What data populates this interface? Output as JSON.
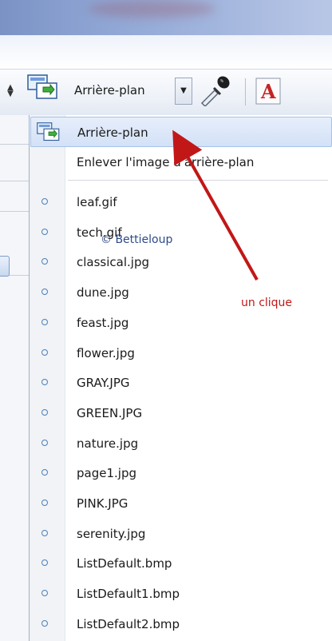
{
  "toolbar": {
    "background_dropdown_label": "Arrière-plan",
    "spin_icon": "up-down-arrows-icon",
    "background_icon": "background-image-icon",
    "dropdown_arrow_icon": "chevron-down-icon",
    "eyedropper_icon": "eyedropper-icon",
    "text_icon": "text-color-icon"
  },
  "menu": {
    "top_items": [
      {
        "label": "Arrière-plan",
        "highlighted": true,
        "icon": "background-image-icon"
      },
      {
        "label": "Enlever l'image d'arrière-plan",
        "highlighted": false
      }
    ],
    "files": [
      "leaf.gif",
      "tech.gif",
      "classical.jpg",
      "dune.jpg",
      "feast.jpg",
      "flower.jpg",
      "GRAY.JPG",
      "GREEN.JPG",
      "nature.jpg",
      "page1.jpg",
      "PINK.JPG",
      "serenity.jpg",
      "ListDefault.bmp",
      "ListDefault1.bmp",
      "ListDefault2.bmp"
    ],
    "radio_icon": "radio-bullet-icon"
  },
  "annotations": {
    "watermark": "© Bettieloup",
    "click_note": "un clique",
    "arrow_color": "#c21717"
  },
  "colors": {
    "highlight": "#d3e1f7",
    "radio": "#4a80b8"
  }
}
